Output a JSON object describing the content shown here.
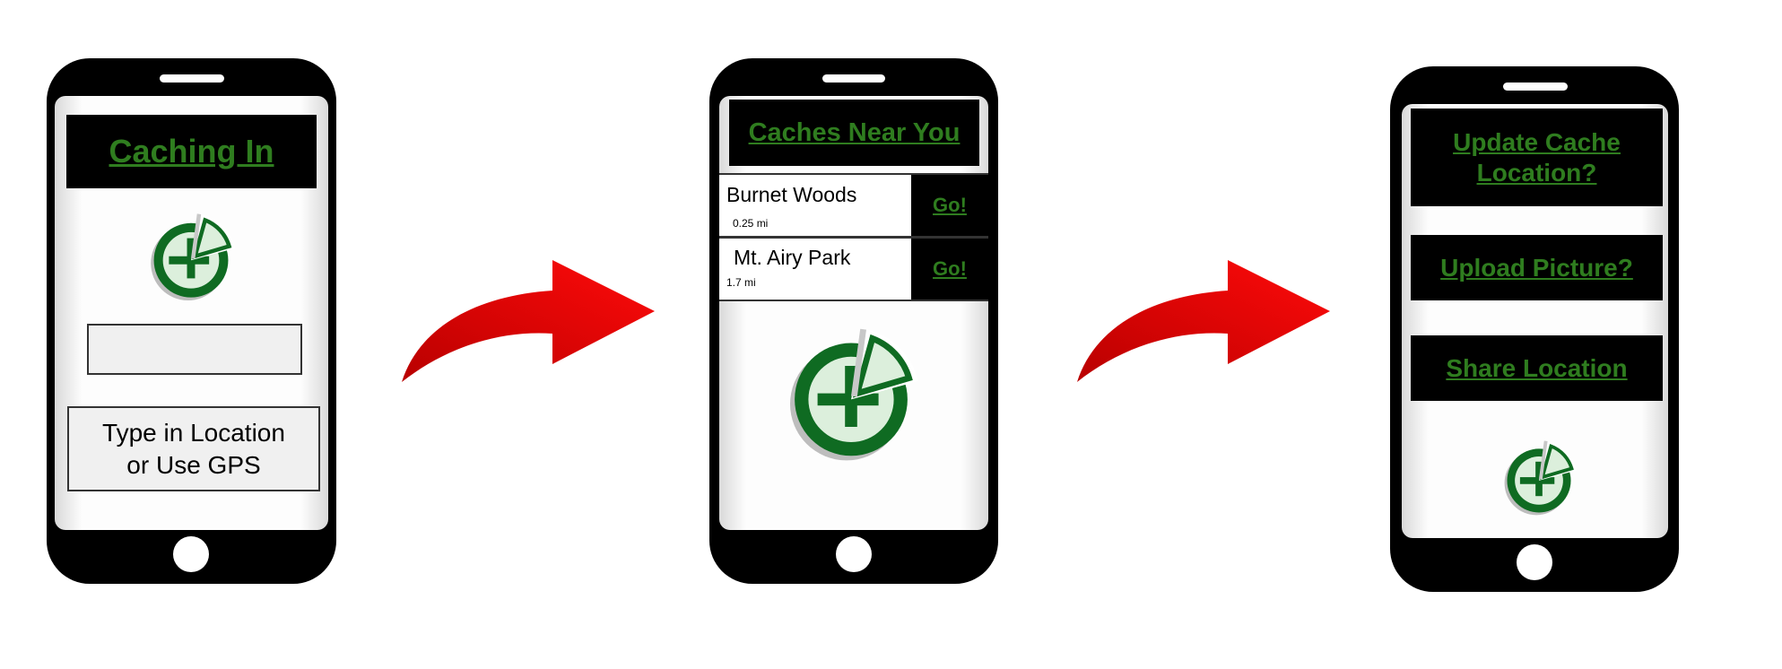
{
  "colors": {
    "accent_green": "#2f7d1f",
    "arrow_red": "#e60000",
    "dark_green": "#0f6b22"
  },
  "screen1": {
    "title": "Caching In",
    "location_input": "",
    "hint_line1": "Type in Location",
    "hint_line2": "or Use GPS"
  },
  "screen2": {
    "title": "Caches Near You",
    "caches": [
      {
        "name": "Burnet Woods",
        "distance": "0.25 mi",
        "action": "Go!"
      },
      {
        "name": "Mt. Airy Park",
        "distance": "1.7 mi",
        "action": "Go!"
      }
    ]
  },
  "screen3": {
    "update_line1": "Update Cache",
    "update_line2": "Location?",
    "upload": "Upload Picture?",
    "share": "Share Location"
  },
  "icons": [
    "geocache-logo-icon",
    "arrow-right-icon",
    "home-button-icon",
    "speaker-icon"
  ]
}
